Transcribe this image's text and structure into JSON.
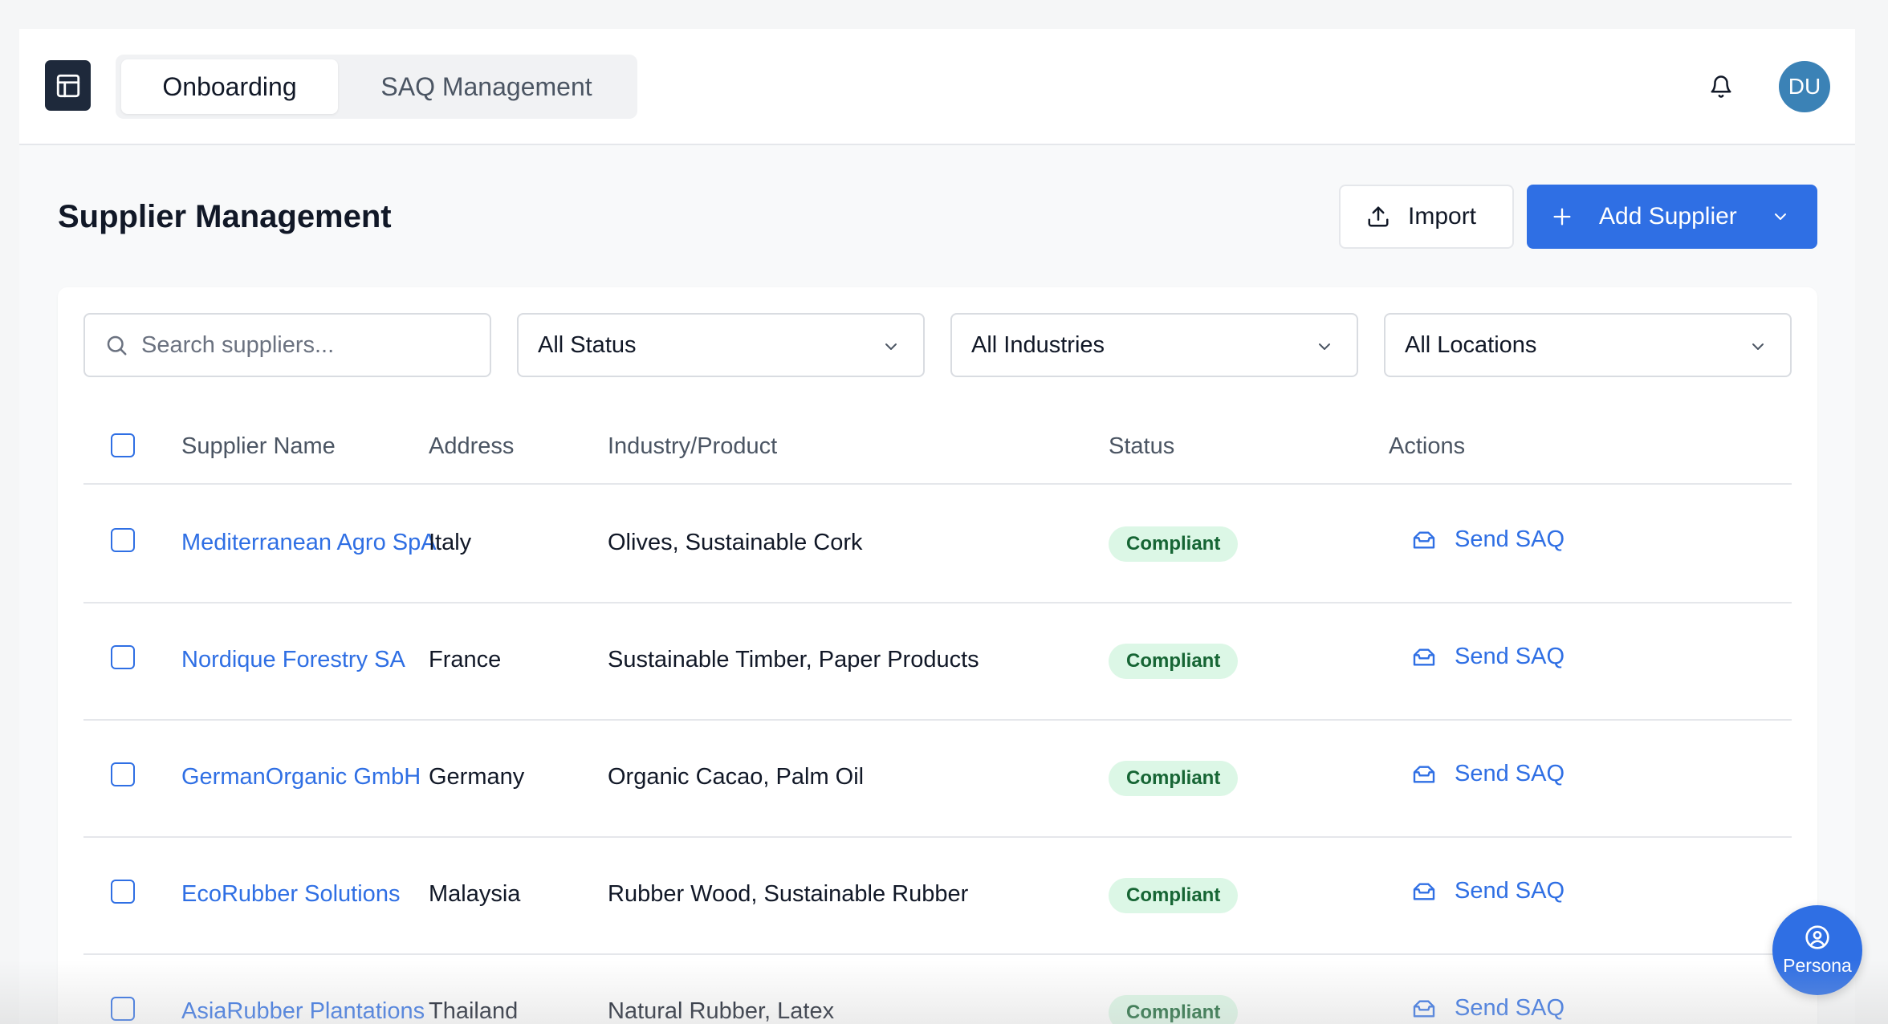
{
  "header": {
    "tabs": [
      {
        "label": "Onboarding",
        "active": true
      },
      {
        "label": "SAQ Management",
        "active": false
      }
    ],
    "avatar_initials": "DU"
  },
  "page": {
    "title": "Supplier Management",
    "import_label": "Import",
    "add_label": "Add Supplier"
  },
  "filters": {
    "search_placeholder": "Search suppliers...",
    "status": "All Status",
    "industries": "All Industries",
    "locations": "All Locations"
  },
  "table": {
    "columns": [
      "Supplier Name",
      "Address",
      "Industry/Product",
      "Status",
      "Actions"
    ],
    "rows": [
      {
        "name": "Mediterranean Agro SpA",
        "address": "Italy",
        "industry": "Olives, Sustainable Cork",
        "status": "Compliant",
        "action": "Send SAQ"
      },
      {
        "name": "Nordique Forestry SA",
        "address": "France",
        "industry": "Sustainable Timber, Paper Products",
        "status": "Compliant",
        "action": "Send SAQ"
      },
      {
        "name": "GermanOrganic GmbH",
        "address": "Germany",
        "industry": "Organic Cacao, Palm Oil",
        "status": "Compliant",
        "action": "Send SAQ"
      },
      {
        "name": "EcoRubber Solutions",
        "address": "Malaysia",
        "industry": "Rubber Wood, Sustainable Rubber",
        "status": "Compliant",
        "action": "Send SAQ"
      },
      {
        "name": "AsiaRubber Plantations",
        "address": "Thailand",
        "industry": "Natural Rubber, Latex",
        "status": "Compliant",
        "action": "Send SAQ"
      }
    ]
  },
  "persona_label": "Persona",
  "colors": {
    "accent": "#2f6fe4",
    "logo_bg": "#1e293b",
    "avatar_bg": "#3b82b6",
    "badge_bg": "#dcf7e6",
    "badge_text": "#166534"
  }
}
